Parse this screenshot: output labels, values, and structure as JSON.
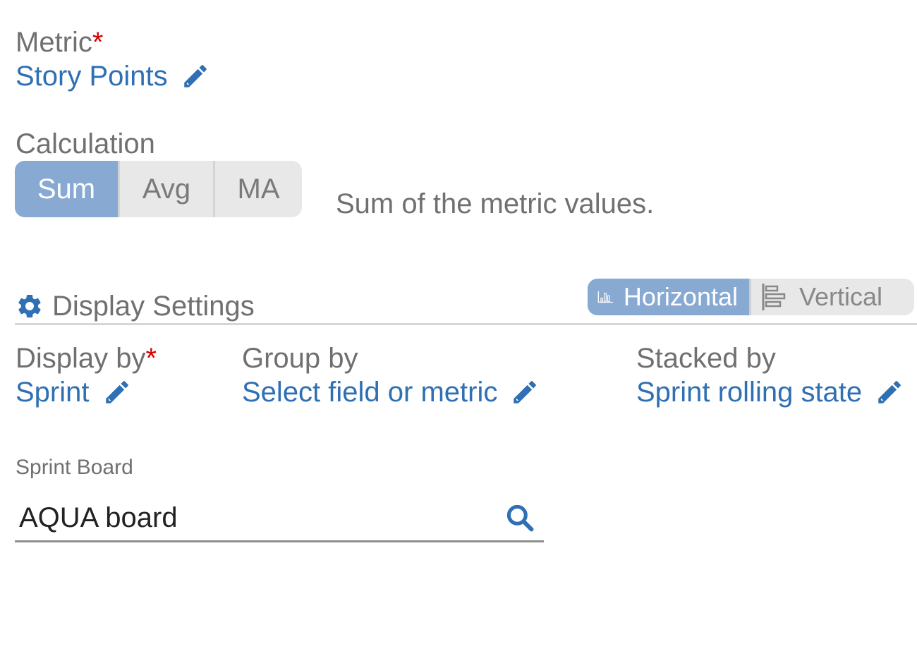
{
  "metric": {
    "label": "Metric",
    "required_mark": "*",
    "value": "Story Points",
    "edit_icon": "pencil-icon"
  },
  "calculation": {
    "label": "Calculation",
    "options": [
      "Sum",
      "Avg",
      "MA"
    ],
    "selected": "Sum",
    "description": "Sum of the metric values."
  },
  "display_settings": {
    "title": "Display Settings",
    "icon": "gear-icon",
    "orientation": {
      "options": [
        "Horizontal",
        "Vertical"
      ],
      "selected": "Horizontal"
    }
  },
  "display_by": {
    "label": "Display by",
    "required_mark": "*",
    "value": "Sprint"
  },
  "group_by": {
    "label": "Group by",
    "value": "Select field or metric"
  },
  "stacked_by": {
    "label": "Stacked by",
    "value": "Sprint rolling state"
  },
  "sprint_board": {
    "label": "Sprint Board",
    "value": "AQUA board",
    "icon": "search-icon"
  },
  "colors": {
    "link": "#2f6fb3",
    "active_segment": "#88a9d2",
    "required": "#d40000",
    "label": "#707070"
  }
}
